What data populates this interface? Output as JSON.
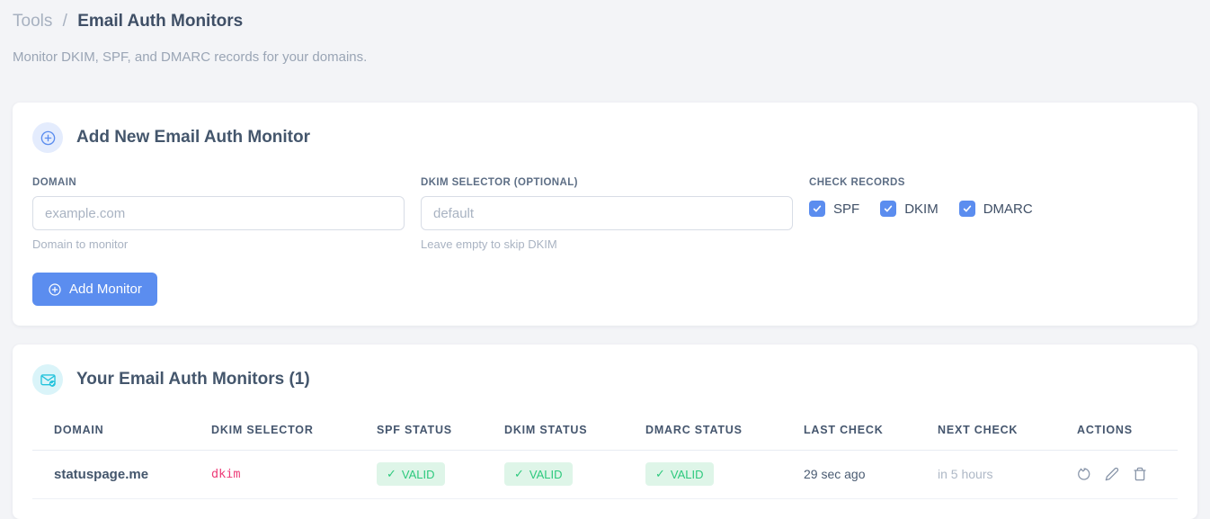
{
  "header": {
    "breadcrumb_section": "Tools",
    "breadcrumb_separator": "/",
    "title": "Email Auth Monitors",
    "subtitle": "Monitor DKIM, SPF, and DMARC records for your domains."
  },
  "add_card": {
    "title": "Add New Email Auth Monitor",
    "header_icon": "plus-circle-icon",
    "domain_field": {
      "label": "DOMAIN",
      "placeholder": "example.com",
      "value": "",
      "helper": "Domain to monitor"
    },
    "dkim_field": {
      "label": "DKIM SELECTOR (OPTIONAL)",
      "placeholder": "default",
      "value": "",
      "helper": "Leave empty to skip DKIM"
    },
    "check_records": {
      "label": "CHECK RECORDS",
      "options": [
        {
          "label": "SPF",
          "checked": true
        },
        {
          "label": "DKIM",
          "checked": true
        },
        {
          "label": "DMARC",
          "checked": true
        }
      ]
    },
    "submit_label": "Add Monitor"
  },
  "monitors_card": {
    "title": "Your Email Auth Monitors (1)",
    "header_icon": "envelope-check-icon",
    "table": {
      "columns": [
        "DOMAIN",
        "DKIM SELECTOR",
        "SPF STATUS",
        "DKIM STATUS",
        "DMARC STATUS",
        "LAST CHECK",
        "NEXT CHECK",
        "ACTIONS"
      ],
      "rows": [
        {
          "domain": "statuspage.me",
          "dkim_selector": "dkim",
          "spf_status": "VALID",
          "dkim_status": "VALID",
          "dmarc_status": "VALID",
          "last_check": "29 sec ago",
          "next_check": "in 5 hours",
          "actions": [
            "refresh",
            "edit",
            "delete"
          ]
        }
      ]
    }
  },
  "icons": {
    "check_glyph": "✓"
  },
  "colors": {
    "page_bg": "#f3f4f7",
    "accent_blue": "#5b8def",
    "accent_cyan": "#23c3dc",
    "badge_green_text": "#2dc97d",
    "badge_green_bg": "#def5e8",
    "selector_pink": "#ed3c78"
  }
}
